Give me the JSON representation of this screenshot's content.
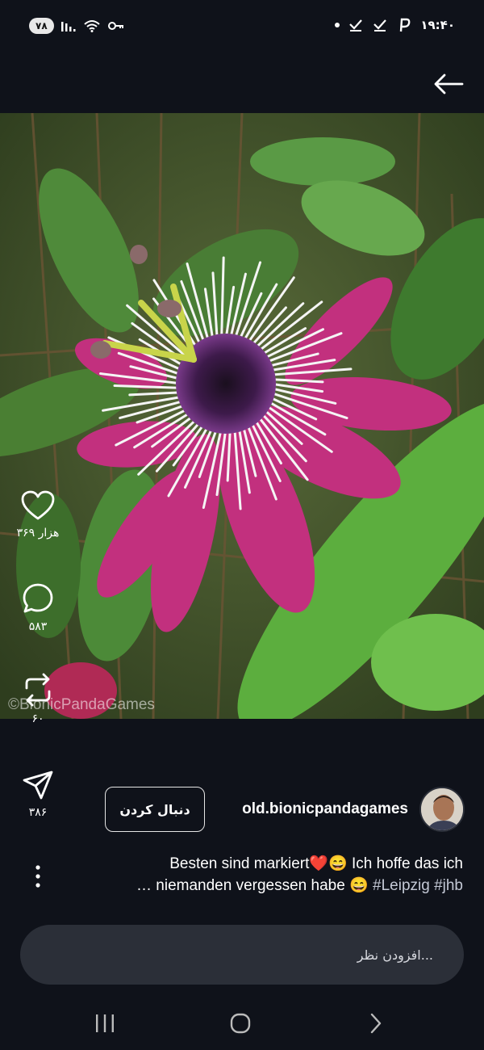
{
  "status_bar": {
    "battery": "۷۸",
    "time": "۱۹:۴۰"
  },
  "post": {
    "watermark": "©BionicPandaGames",
    "likes": "۳۶۹ هزار",
    "comments": "۵۸۳",
    "reposts": "۶۰",
    "shares": "۳۸۶",
    "username": "old.bionicpandagames",
    "follow_label": "دنبال کردن",
    "caption_line1": "Besten sind markiert❤️😄 Ich hoffe das ich",
    "caption_line2_prefix": "… niemanden vergessen habe 😄 ",
    "hashtags": "#Leipzig #jhb"
  },
  "comment_input": {
    "placeholder": "افزودن نظر..."
  },
  "icons": [
    "wifi-icon",
    "signal-icon",
    "key-icon",
    "check-icon",
    "p-icon",
    "back-arrow-icon",
    "heart-icon",
    "comment-icon",
    "repost-icon",
    "send-icon",
    "more-icon",
    "recent-apps-icon",
    "home-icon",
    "nav-back-icon"
  ],
  "colors": {
    "background": "#0f121a",
    "input_bg": "#2b2f38",
    "flower_petal": "#c2307e"
  }
}
